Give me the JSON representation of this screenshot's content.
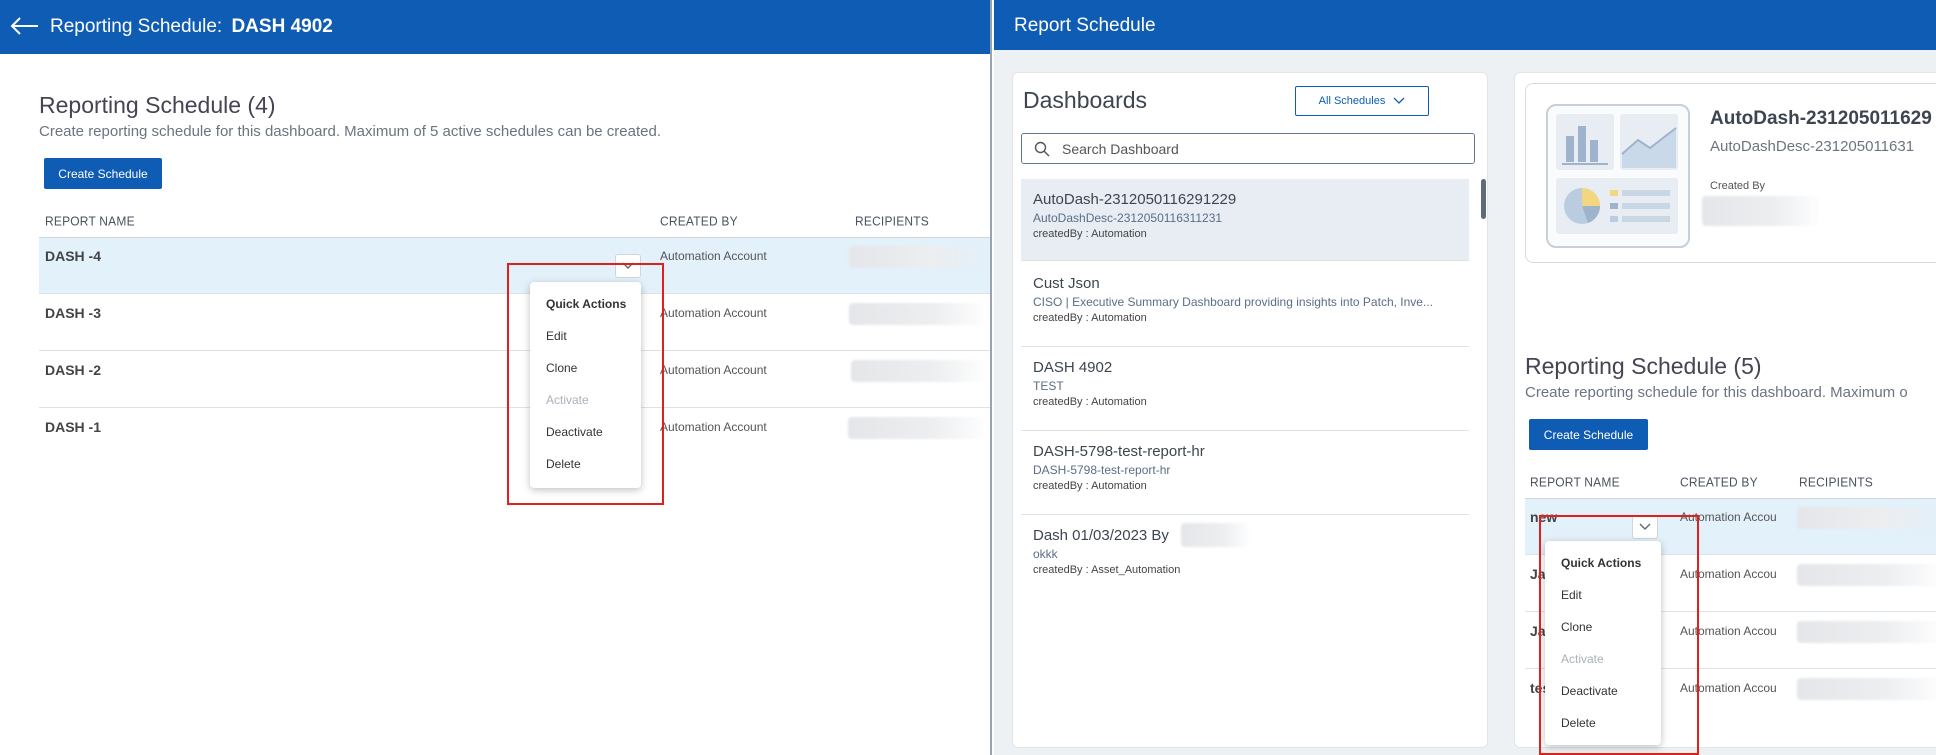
{
  "left": {
    "header_title": "Reporting Schedule:",
    "header_dashboard": "DASH 4902",
    "section_title": "Reporting Schedule (4)",
    "section_subtitle": "Create reporting schedule for this dashboard. Maximum of 5 active schedules can be created.",
    "create_button": "Create Schedule",
    "columns": {
      "name": "REPORT NAME",
      "created_by": "CREATED BY",
      "recipients": "RECIPIENTS"
    },
    "rows": [
      {
        "name": "DASH -4",
        "created_by": "Automation Account"
      },
      {
        "name": "DASH -3",
        "created_by": "Automation Account"
      },
      {
        "name": "DASH -2",
        "created_by": "Automation Account"
      },
      {
        "name": "DASH -1",
        "created_by": "Automation Account"
      }
    ],
    "menu": {
      "heading": "Quick Actions",
      "items": [
        "Edit",
        "Clone",
        "Activate",
        "Deactivate",
        "Delete"
      ]
    }
  },
  "right": {
    "header_title": "Report Schedule",
    "dashboards_title": "Dashboards",
    "filter_label": "All Schedules",
    "search_placeholder": "Search Dashboard",
    "dashboards": [
      {
        "title": "AutoDash-2312050116291229",
        "desc": "AutoDashDesc-2312050116311231",
        "by": "createdBy : Automation"
      },
      {
        "title": "Cust Json",
        "desc": "CISO | Executive Summary Dashboard providing insights into Patch, Inve...",
        "by": "createdBy : Automation"
      },
      {
        "title": "DASH 4902",
        "desc": "TEST",
        "by": "createdBy : Automation"
      },
      {
        "title": "DASH-5798-test-report-hr",
        "desc": "DASH-5798-test-report-hr",
        "by": "createdBy : Automation"
      },
      {
        "title": "Dash 01/03/2023 By",
        "desc": "okkk",
        "by": "createdBy : Asset_Automation"
      }
    ],
    "detail": {
      "title": "AutoDash-231205011629",
      "desc": "AutoDashDesc-231205011631",
      "created_by_label": "Created By"
    },
    "section_title": "Reporting Schedule (5)",
    "section_subtitle": "Create reporting schedule for this dashboard. Maximum o",
    "create_button": "Create Schedule",
    "columns": {
      "name": "REPORT NAME",
      "created_by": "CREATED BY",
      "recipients": "RECIPIENTS"
    },
    "rows": [
      {
        "name": "new",
        "created_by": "Automation Accou"
      },
      {
        "name": "Ja",
        "created_by": "Automation Accou"
      },
      {
        "name": "Ja",
        "created_by": "Automation Accou"
      },
      {
        "name": "tes",
        "created_by": "Automation Accou"
      }
    ],
    "menu": {
      "heading": "Quick Actions",
      "items": [
        "Edit",
        "Clone",
        "Activate",
        "Deactivate",
        "Delete"
      ]
    }
  },
  "colors": {
    "header_blue": "#0f5cb5",
    "highlight_row": "#e3f1fb",
    "annotation_red": "#e0201c"
  },
  "icons": [
    "back-arrow-icon",
    "chevron-down-icon",
    "search-icon",
    "dashboard-thumbnail-icon"
  ]
}
